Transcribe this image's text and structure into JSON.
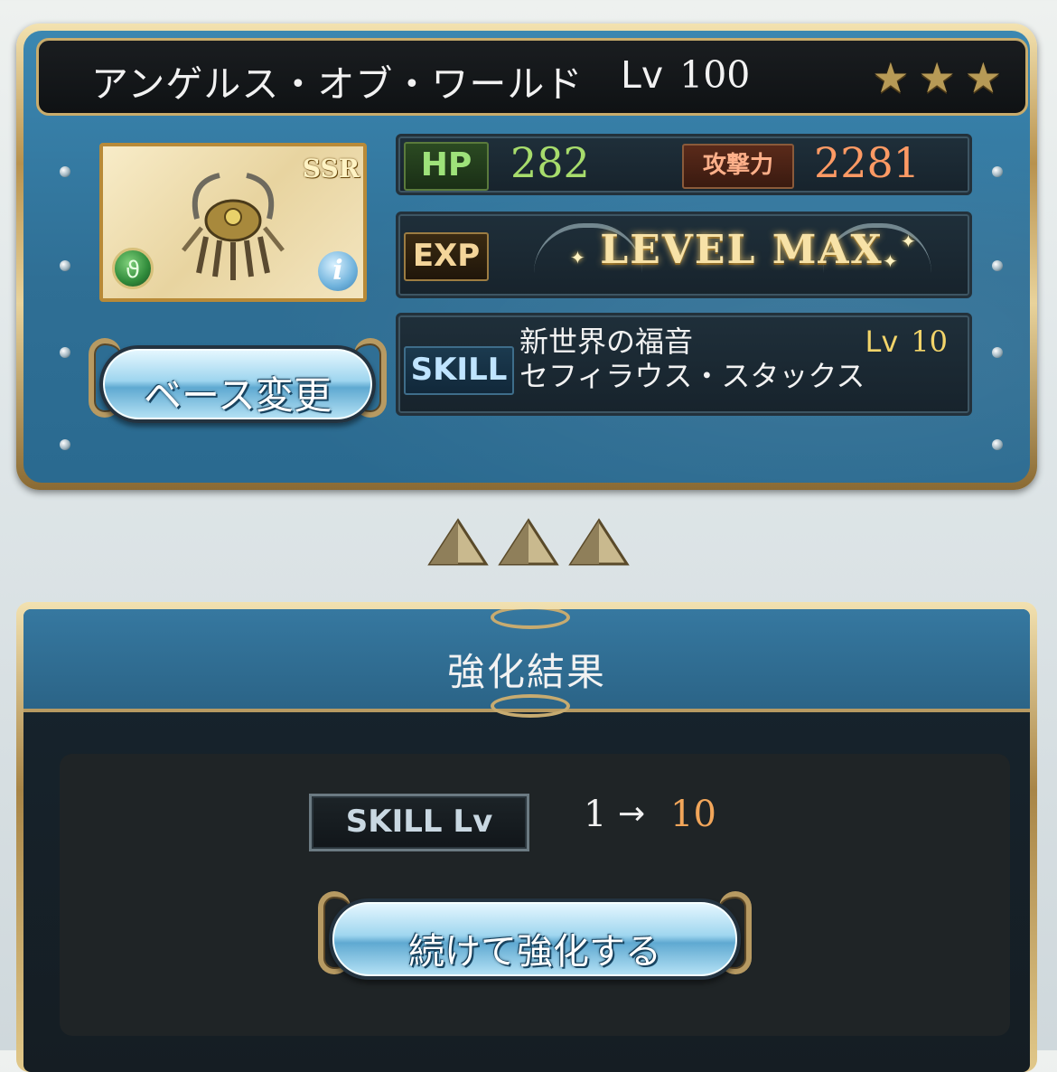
{
  "weapon": {
    "name": "アンゲルス・オブ・ワールド",
    "level_label": "Lv",
    "level": "100",
    "rarity_badge": "SSR",
    "stars": [
      "★",
      "★",
      "★"
    ]
  },
  "stats": {
    "hp_label": "HP",
    "hp": "282",
    "atk_label": "攻撃力",
    "atk": "2281",
    "exp_label": "EXP",
    "exp_status": "LEVEL MAX"
  },
  "skill": {
    "label": "SKILL",
    "name_line1": "新世界の福音",
    "name_line2": "セフィラウス・スタックス",
    "level_label": "Lv",
    "level": "10"
  },
  "buttons": {
    "base_change": "ベース変更",
    "continue_upgrade": "続けて強化する"
  },
  "result": {
    "title": "強化結果",
    "skill_lv_label": "SKILL Lv",
    "from": "1",
    "arrow": "→",
    "to": "10"
  },
  "colors": {
    "hp": "#a7dc6c",
    "atk": "#ff9a64",
    "skill_lv": "#f2d46a",
    "result_to": "#f2a65a"
  }
}
